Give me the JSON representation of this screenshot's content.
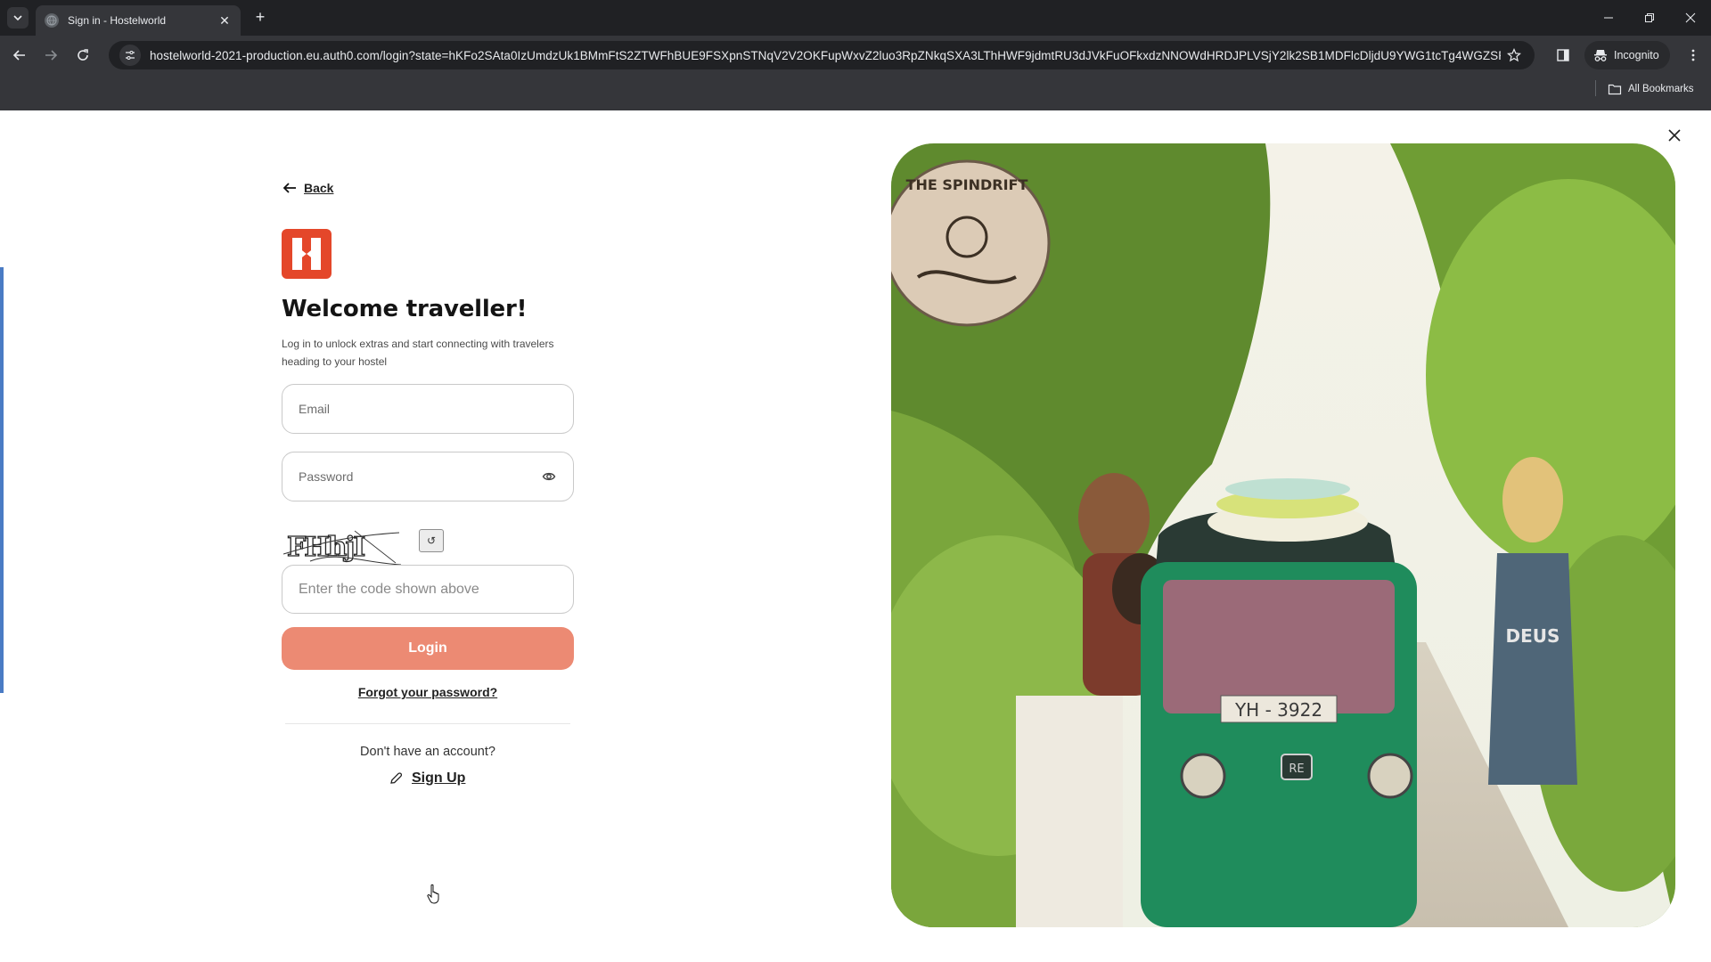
{
  "browser": {
    "tab_title": "Sign in - Hostelworld",
    "url": "hostelworld-2021-production.eu.auth0.com/login?state=hKFo2SAta0IzUmdzUk1BMmFtS2ZTWFhBUE9FSXpnSTNqV2V2OKFupWxvZ2luo3RpZNkqSXA3LThHWF9jdmtRU3dJVkFuOFkxdzNNOWdHRDJPLVSjY2lk2SB1MDFlcDljdU9YWG1tcTg4WGZSRFZ...",
    "profile_label": "Incognito",
    "bookmarks_label": "All Bookmarks"
  },
  "page": {
    "back_label": "Back",
    "brand": "Hostelworld",
    "heading": "Welcome traveller!",
    "subtitle": "Log in to unlock extras and start connecting with travelers heading to your hostel",
    "email": {
      "value": "",
      "placeholder": "Email"
    },
    "password": {
      "value": "",
      "placeholder": "Password"
    },
    "captcha": {
      "image_text": "FHhjI",
      "refresh_glyph": "↺",
      "value": "",
      "placeholder": "Enter the code shown above"
    },
    "login_label": "Login",
    "forgot_label": "Forgot your password?",
    "no_account_label": "Don't have an account?",
    "signup_label": "Sign Up",
    "hero": {
      "sign_text": "THE SPINDRIFT",
      "plate_text": "YH - 3922",
      "badge_text": "RE",
      "shirt_text": "DEUS"
    }
  },
  "colors": {
    "brand": "#e4472a",
    "login_button": "#ec8a73",
    "accent_bar": "#4a7bc4"
  }
}
